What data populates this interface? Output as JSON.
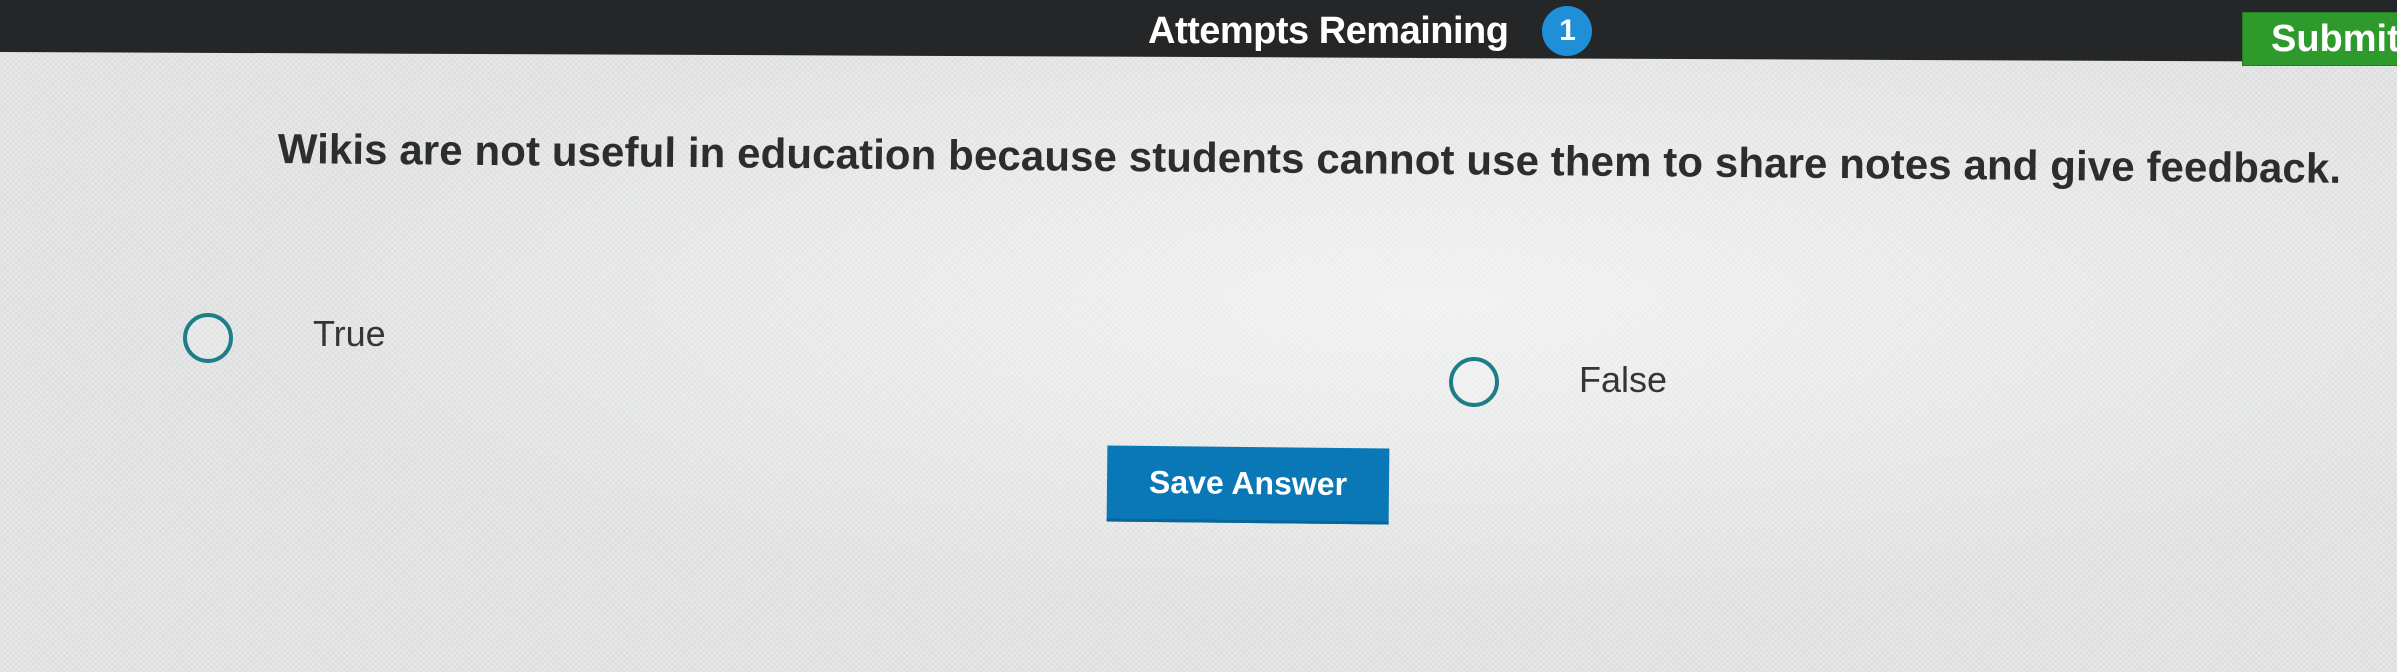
{
  "header": {
    "attempts_label": "Attempts Remaining",
    "attempts_count": "1",
    "submit_label": "Submit",
    "colors": {
      "bar": "#242627",
      "badge": "#1f8fd8",
      "submit": "#2e9a2b"
    }
  },
  "question": {
    "text": "Wikis are not useful in education because students cannot use them to share notes and give feedback."
  },
  "options": [
    {
      "label": "True",
      "selected": false
    },
    {
      "label": "False",
      "selected": false
    }
  ],
  "actions": {
    "save_label": "Save Answer",
    "save_color": "#0a78b7"
  },
  "icons": {
    "radio": "radio-circle-icon"
  }
}
